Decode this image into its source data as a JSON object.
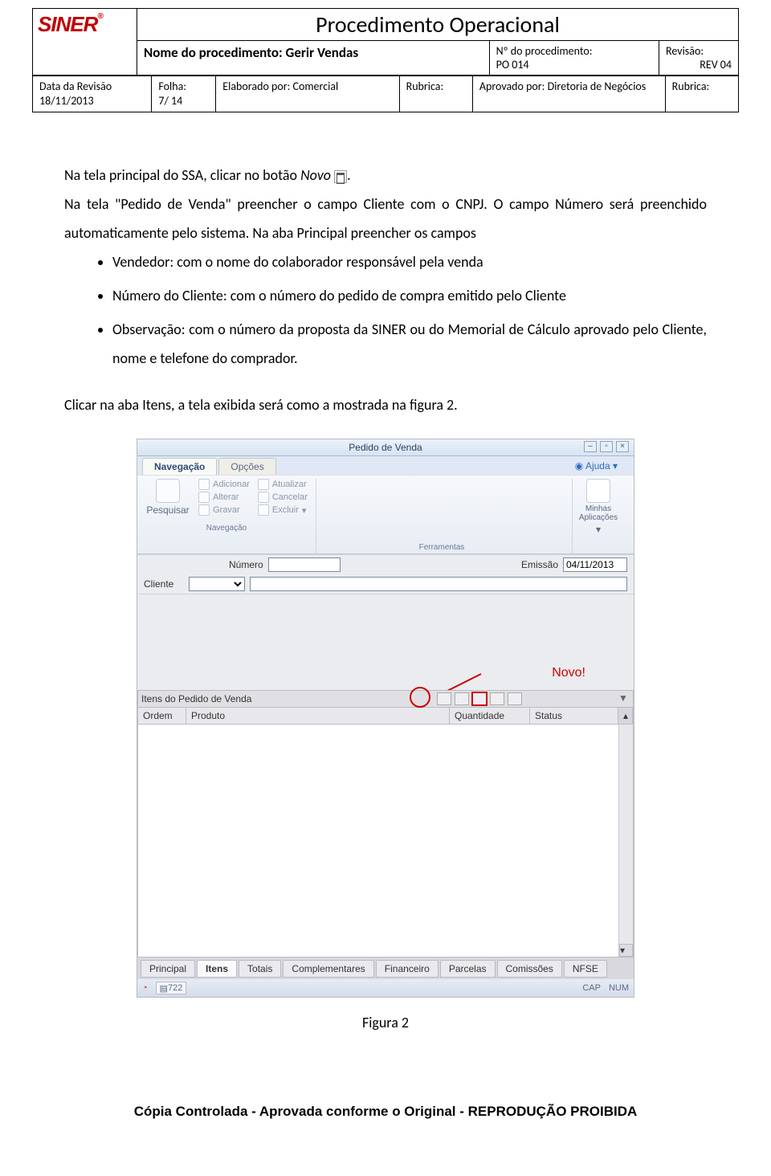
{
  "header": {
    "logo_text": "SINER",
    "logo_reg": "®",
    "title": "Procedimento Operacional",
    "proc_label": "Nome do procedimento: Gerir Vendas",
    "numproc_label": "Nº do procedimento:",
    "numproc_value": "PO 014",
    "rev_label": "Revisão:",
    "rev_value": "REV 04",
    "date_label": "Data da Revisão",
    "date_value": "18/11/2013",
    "folha_label": "Folha:",
    "folha_value": "7/ 14",
    "elab_label": "Elaborado por: Comercial",
    "rubrica_label": "Rubrica:",
    "aprov_label": "Aprovado por: Diretoria de Negócios",
    "rubrica2_label": "Rubrica:"
  },
  "text": {
    "p1a": "Na tela principal do SSA, clicar no botão ",
    "p1b_italic": "Novo",
    "p1c": ".",
    "p2": "Na tela \"Pedido de Venda\" preencher o campo Cliente com o CNPJ. O campo Número será preenchido automaticamente pelo sistema. Na aba Principal preencher os campos",
    "li1": "Vendedor: com o nome do colaborador responsável pela venda",
    "li2": "Número do Cliente: com o número do pedido de compra emitido pelo Cliente",
    "li3": "Observação: com o número da proposta da SINER ou do Memorial de Cálculo aprovado pelo Cliente, nome e telefone do comprador.",
    "p3": "Clicar na aba Itens, a tela exibida será como a mostrada na figura 2.",
    "figcap": "Figura 2"
  },
  "shot": {
    "title": "Pedido de Venda",
    "tabs": {
      "nav": "Navegação",
      "opc": "Opções",
      "help": "Ajuda"
    },
    "ribbon": {
      "pesquisar": "Pesquisar",
      "adicionar": "Adicionar",
      "atualizar": "Atualizar",
      "alterar": "Alterar",
      "cancelar": "Cancelar",
      "gravar": "Gravar",
      "excluir": "Excluir",
      "nav_group": "Navegação",
      "ferr_group": "Ferramentas",
      "apps": "Minhas Aplicações"
    },
    "form": {
      "numero_lbl": "Número",
      "emissao_lbl": "Emissão",
      "emissao_val": "04/11/2013",
      "cliente_lbl": "Cliente"
    },
    "annot_novo": "Novo!",
    "items_bar": "Itens do Pedido de Venda",
    "grid": {
      "ordem": "Ordem",
      "produto": "Produto",
      "qtd": "Quantidade",
      "status": "Status"
    },
    "btabs": {
      "principal": "Principal",
      "itens": "Itens",
      "totais": "Totais",
      "compl": "Complementares",
      "fin": "Financeiro",
      "parc": "Parcelas",
      "com": "Comissões",
      "nfse": "NFSE"
    },
    "status": {
      "rec": "722",
      "caps": "CAP",
      "num": "NUM"
    }
  },
  "footer": "Cópia Controlada - Aprovada conforme o Original - REPRODUÇÃO PROIBIDA"
}
